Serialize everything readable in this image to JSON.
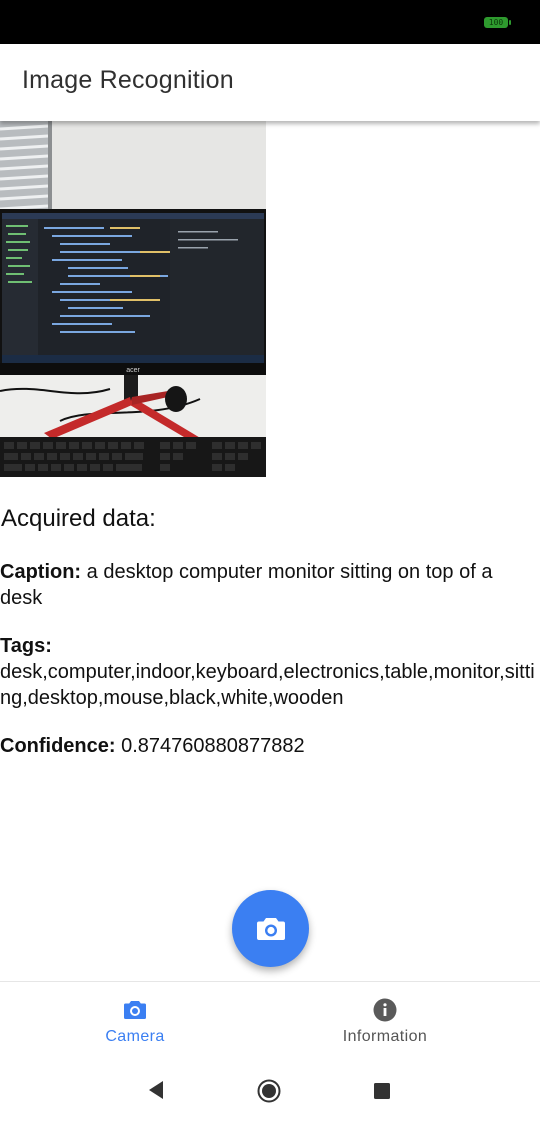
{
  "status_bar": {
    "battery_level": "100"
  },
  "app_bar": {
    "title": "Image Recognition"
  },
  "result": {
    "heading": "Acquired data:",
    "caption_label": "Caption:",
    "caption_value": "a desktop computer monitor sitting on top of a desk",
    "tags_label": "Tags:",
    "tags_value": "desk,computer,indoor,keyboard,electronics,table,monitor,sitting,desktop,mouse,black,white,wooden",
    "confidence_label": "Confidence:",
    "confidence_value": "0.874760880877882"
  },
  "fab": {
    "icon": "camera-icon"
  },
  "bottom_nav": {
    "items": [
      {
        "label": "Camera",
        "icon": "camera-icon",
        "active": true,
        "color": "#3b7ff2"
      },
      {
        "label": "Information",
        "icon": "info-icon",
        "active": false,
        "color": "#555555"
      }
    ]
  },
  "photo_text": {
    "monitor_brand": "acer"
  },
  "colors": {
    "accent": "#3b7ff2",
    "status_bar": "#000000",
    "battery": "#2e9a2e"
  }
}
